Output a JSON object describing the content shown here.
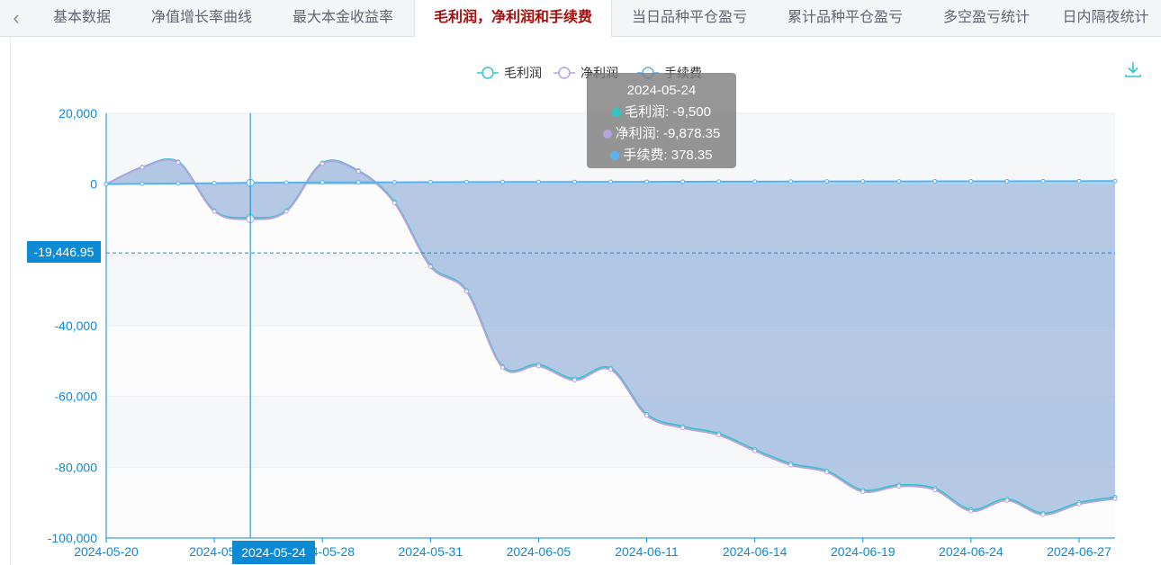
{
  "tabs": {
    "back_icon": "chevron-left-icon",
    "items": [
      {
        "label": "基本数据",
        "active": false
      },
      {
        "label": "净值增长率曲线",
        "active": false
      },
      {
        "label": "最大本金收益率",
        "active": false
      },
      {
        "label": "毛利润，净利润和手续费",
        "active": true
      },
      {
        "label": "当日品种平仓盈亏",
        "active": false
      },
      {
        "label": "累计品种平仓盈亏",
        "active": false
      },
      {
        "label": "多空盈亏统计",
        "active": false
      },
      {
        "label": "日内隔夜统计",
        "active": false
      }
    ]
  },
  "toolbox": {
    "download_icon": "download-icon"
  },
  "tooltip": {
    "date": "2024-05-24",
    "rows": [
      {
        "text": "毛利润: -9,500",
        "color": "#2ec7c9"
      },
      {
        "text": "净利润: -9,878.35",
        "color": "#b6a2de"
      },
      {
        "text": "手续费: 378.35",
        "color": "#5ab1ef"
      }
    ]
  },
  "crosshair": {
    "y_value_label": "-19,446.95",
    "x_value_label": "2024-05-24"
  },
  "chart_data": {
    "type": "area",
    "legend_position": "top-center",
    "ylim": [
      -100000,
      20000
    ],
    "yticks": [
      "20,000",
      "0",
      "-40,000",
      "-60,000",
      "-80,000",
      "-100,000"
    ],
    "x_tick_labels": [
      "2024-05-20",
      "2024-05-",
      "2024-05-28",
      "2024-05-31",
      "2024-06-05",
      "2024-06-11",
      "2024-06-14",
      "2024-06-19",
      "2024-06-24",
      "2024-06-27"
    ],
    "x": [
      "2024-05-20",
      "2024-05-21",
      "2024-05-22",
      "2024-05-23",
      "2024-05-24",
      "2024-05-27",
      "2024-05-28",
      "2024-05-29",
      "2024-05-30",
      "2024-05-31",
      "2024-06-03",
      "2024-06-04",
      "2024-06-05",
      "2024-06-06",
      "2024-06-07",
      "2024-06-11",
      "2024-06-12",
      "2024-06-13",
      "2024-06-14",
      "2024-06-17",
      "2024-06-18",
      "2024-06-19",
      "2024-06-20",
      "2024-06-21",
      "2024-06-24",
      "2024-06-25",
      "2024-06-26",
      "2024-06-27",
      "2024-06-28"
    ],
    "series": [
      {
        "name": "毛利润",
        "color": "#2ec7c9",
        "values": [
          0,
          4800,
          6300,
          -7500,
          -9500,
          -7500,
          6000,
          3800,
          -5000,
          -23000,
          -30000,
          -51500,
          -51000,
          -55000,
          -52000,
          -65000,
          -68500,
          -70500,
          -75000,
          -79000,
          -81000,
          -86500,
          -85000,
          -86000,
          -92000,
          -89000,
          -93000,
          -90000,
          -88500
        ]
      },
      {
        "name": "净利润",
        "color": "#b6a2de",
        "values": [
          0,
          4700,
          6100,
          -7700,
          -9878.35,
          -7700,
          5800,
          3600,
          -5300,
          -23300,
          -30300,
          -51800,
          -51400,
          -55400,
          -52400,
          -65400,
          -68900,
          -70900,
          -75400,
          -79400,
          -81400,
          -86900,
          -85400,
          -86400,
          -92400,
          -89400,
          -93400,
          -90400,
          -88900
        ]
      },
      {
        "name": "手续费",
        "color": "#5ab1ef",
        "values": [
          0,
          100,
          180,
          250,
          378.35,
          420,
          480,
          500,
          520,
          550,
          580,
          600,
          620,
          630,
          650,
          660,
          680,
          700,
          720,
          740,
          760,
          770,
          780,
          790,
          800,
          820,
          830,
          850,
          860
        ]
      }
    ]
  }
}
